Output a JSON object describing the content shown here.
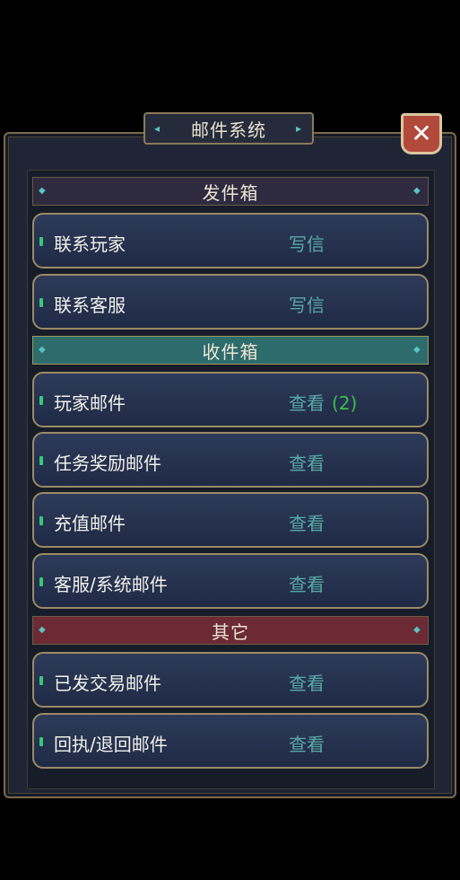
{
  "title": "邮件系统",
  "close_icon": "close-icon",
  "colors": {
    "section_send": "#2e2a3f",
    "section_recv": "#2e6b6c",
    "section_other": "#6b2a34",
    "action_text": "#58a9a6",
    "count_text": "#3bbf4a"
  },
  "sections": {
    "send": "发件箱",
    "recv": "收件箱",
    "other": "其它"
  },
  "rows": [
    {
      "name": "联系玩家",
      "action": "写信",
      "count": ""
    },
    {
      "name": "联系客服",
      "action": "写信",
      "count": ""
    },
    {
      "name": "玩家邮件",
      "action": "查看",
      "count": "(2)"
    },
    {
      "name": "任务奖励邮件",
      "action": "查看",
      "count": ""
    },
    {
      "name": "充值邮件",
      "action": "查看",
      "count": ""
    },
    {
      "name": "客服/系统邮件",
      "action": "查看",
      "count": ""
    },
    {
      "name": "已发交易邮件",
      "action": "查看",
      "count": ""
    },
    {
      "name": "回执/退回邮件",
      "action": "查看",
      "count": ""
    }
  ]
}
